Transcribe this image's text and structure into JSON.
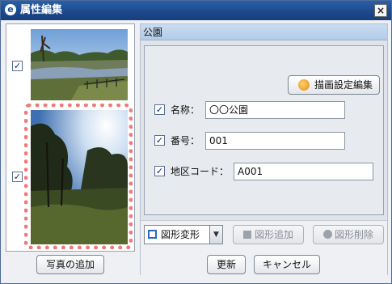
{
  "window": {
    "title": "属性編集",
    "app_icon": "e",
    "close": "×"
  },
  "photos": {
    "add_button": "写真の追加",
    "items": [
      {
        "checked": true
      },
      {
        "checked": true
      }
    ]
  },
  "form": {
    "header": "公園",
    "draw_settings_button": "描画設定編集",
    "fields": [
      {
        "label": "名称：",
        "value": "〇〇公園",
        "checked": true
      },
      {
        "label": "番号：",
        "value": "001",
        "checked": true
      },
      {
        "label": "地区コード：",
        "value": "A001",
        "checked": true
      }
    ]
  },
  "toolbar": {
    "shape_transform": "図形変形",
    "shape_add": "図形追加",
    "shape_delete": "図形削除"
  },
  "footer": {
    "update": "更新",
    "cancel": "キャンセル"
  },
  "check_mark": "✓"
}
